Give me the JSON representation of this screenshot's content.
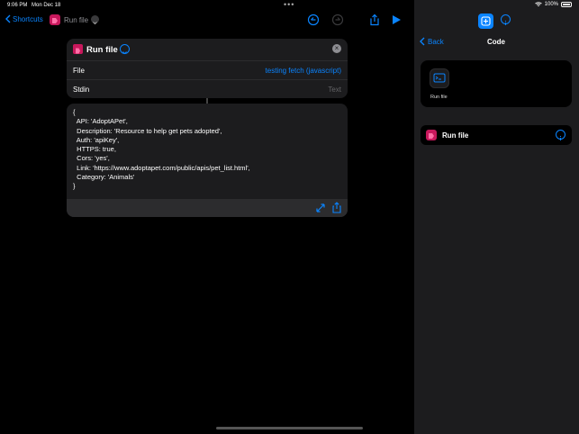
{
  "status": {
    "time": "9:06 PM",
    "date": "Mon Dec 18",
    "battery": "100%"
  },
  "nav": {
    "back_label": "Shortcuts",
    "shortcut_title": "Run file"
  },
  "action_card": {
    "title": "Run file",
    "file_label": "File",
    "file_value": "testing fetch (javascript)",
    "stdin_label": "Stdin",
    "stdin_placeholder": "Text"
  },
  "code_block": {
    "lines": "{\n  API: 'AdoptAPet',\n  Description: 'Resource to help get pets adopted',\n  Auth: 'apiKey',\n  HTTPS: true,\n  Cors: 'yes',\n  Link: 'https://www.adoptapet.com/public/apis/pet_list.html',\n  Category: 'Animals'\n}"
  },
  "right_pane": {
    "back_label": "Back",
    "title": "Code",
    "tile_label": "Run file",
    "action_label": "Run file"
  },
  "colors": {
    "accent": "#0a84ff",
    "app_icon": "#c8185c",
    "card_bg": "#1c1c1e"
  }
}
